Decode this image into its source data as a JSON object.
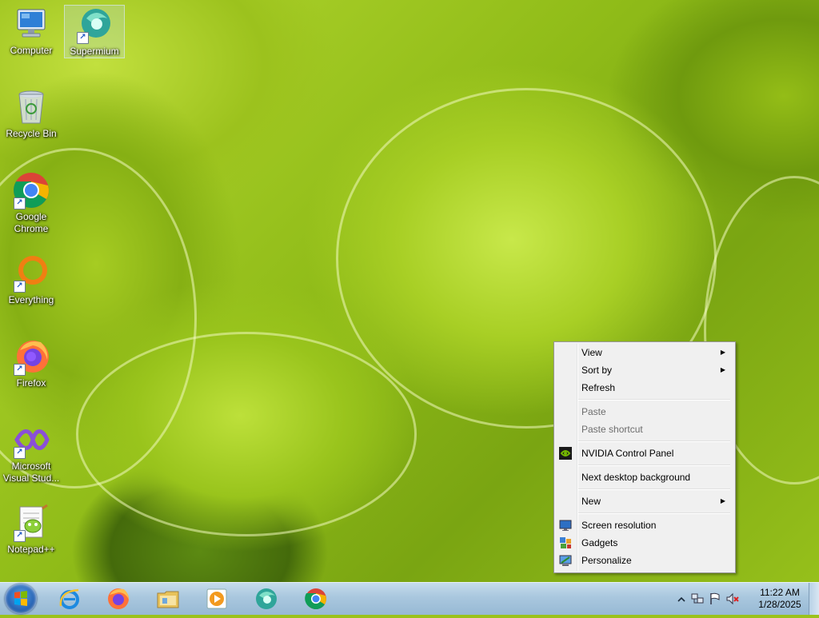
{
  "desktop": {
    "icons": [
      {
        "label": "Computer",
        "icon": "computer-icon"
      },
      {
        "label": "Supermium",
        "icon": "supermium-icon"
      },
      {
        "label": "Recycle Bin",
        "icon": "recycle-bin-icon"
      },
      {
        "label": "Google Chrome",
        "icon": "chrome-icon"
      },
      {
        "label": "Everything",
        "icon": "everything-icon"
      },
      {
        "label": "Firefox",
        "icon": "firefox-icon"
      },
      {
        "label": "Microsoft Visual Stud...",
        "icon": "visual-studio-icon"
      },
      {
        "label": "Notepad++",
        "icon": "notepadpp-icon"
      }
    ]
  },
  "context_menu": {
    "items": [
      {
        "label": "View",
        "submenu": true,
        "enabled": true
      },
      {
        "label": "Sort by",
        "submenu": true,
        "enabled": true
      },
      {
        "label": "Refresh",
        "enabled": true
      },
      {
        "label": "Paste",
        "enabled": false
      },
      {
        "label": "Paste shortcut",
        "enabled": false
      },
      {
        "label": "NVIDIA Control Panel",
        "icon": "nvidia-icon",
        "enabled": true
      },
      {
        "label": "Next desktop background",
        "enabled": true
      },
      {
        "label": "New",
        "submenu": true,
        "enabled": true
      },
      {
        "label": "Screen resolution",
        "icon": "monitor-icon",
        "enabled": true
      },
      {
        "label": "Gadgets",
        "icon": "gadgets-icon",
        "enabled": true
      },
      {
        "label": "Personalize",
        "icon": "personalize-icon",
        "enabled": true
      }
    ]
  },
  "taskbar": {
    "pinned": [
      "start-orb-icon",
      "internet-explorer-icon",
      "firefox-icon",
      "file-explorer-icon",
      "media-player-icon",
      "supermium-icon",
      "chrome-icon"
    ],
    "tray": {
      "icons": [
        "show-hidden-icons-chevron",
        "network-icon",
        "action-center-flag-icon",
        "volume-muted-icon"
      ],
      "time": "11:22 AM",
      "date": "1/28/2025"
    }
  },
  "colors": {
    "taskbar_top": "#c5dcec",
    "taskbar_bottom": "#97b9d4",
    "menu_bg": "#f0f0f0",
    "menu_disabled_text": "#6d6d6d"
  }
}
